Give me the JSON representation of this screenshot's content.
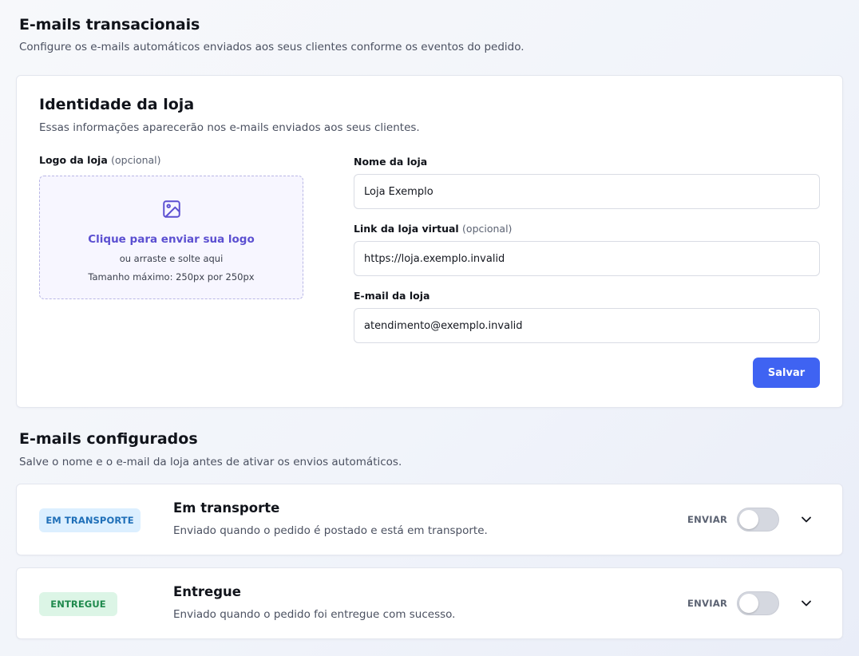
{
  "header": {
    "title": "E-mails transacionais",
    "subtitle": "Configure os e-mails automáticos enviados aos seus clientes conforme os eventos do pedido."
  },
  "identity": {
    "title": "Identidade da loja",
    "subtitle": "Essas informações aparecerão nos e-mails enviados aos seus clientes.",
    "logo": {
      "label": "Logo da loja",
      "optional": "(opcional)",
      "upload_text": "Clique para enviar sua logo",
      "drag_text": "ou arraste e solte aqui",
      "size_text": "Tamanho máximo: 250px por 250px",
      "icon": "image-icon"
    },
    "store_name": {
      "label": "Nome da loja",
      "value": "Loja Exemplo"
    },
    "store_link": {
      "label": "Link da loja virtual",
      "optional": "(opcional)",
      "value": "https://loja.exemplo.invalid"
    },
    "store_email": {
      "label": "E-mail da loja",
      "value": "atendimento@exemplo.invalid"
    },
    "save_label": "Salvar"
  },
  "configured": {
    "title": "E-mails configurados",
    "subtitle": "Salve o nome e o e-mail da loja antes de ativar os envios automáticos.",
    "emails": [
      {
        "badge": "EM TRANSPORTE",
        "badge_color": "#1f6fb8",
        "title": "Em transporte",
        "description": "Enviado quando o pedido é postado e está em transporte.",
        "send_label": "ENVIAR",
        "enabled": false
      },
      {
        "badge": "ENTREGUE",
        "badge_color": "#1f8a4d",
        "title": "Entregue",
        "description": "Enviado quando o pedido foi entregue com sucesso.",
        "send_label": "ENVIAR",
        "enabled": false
      }
    ]
  },
  "colors": {
    "accent": "#3f63f2",
    "upload_accent": "#5b4fd1"
  }
}
